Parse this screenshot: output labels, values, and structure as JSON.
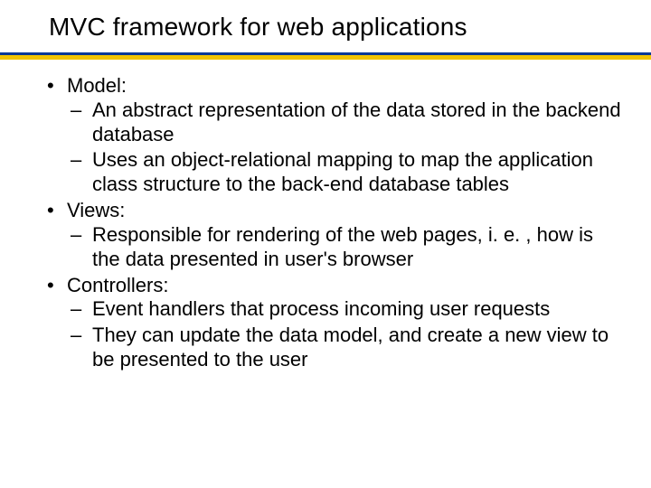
{
  "title": "MVC framework for web applications",
  "bullets": [
    {
      "label": "Model:",
      "subs": [
        "An abstract representation of the data stored in the backend database",
        "Uses an object-relational mapping to map the application class structure to the back-end database tables"
      ]
    },
    {
      "label": "Views:",
      "subs": [
        "Responsible for rendering of the web pages, i. e. , how is the data presented in user's browser"
      ]
    },
    {
      "label": "Controllers:",
      "subs": [
        "Event handlers that process incoming user requests",
        "They can update the data model, and create a new view to be presented to the user"
      ]
    }
  ]
}
